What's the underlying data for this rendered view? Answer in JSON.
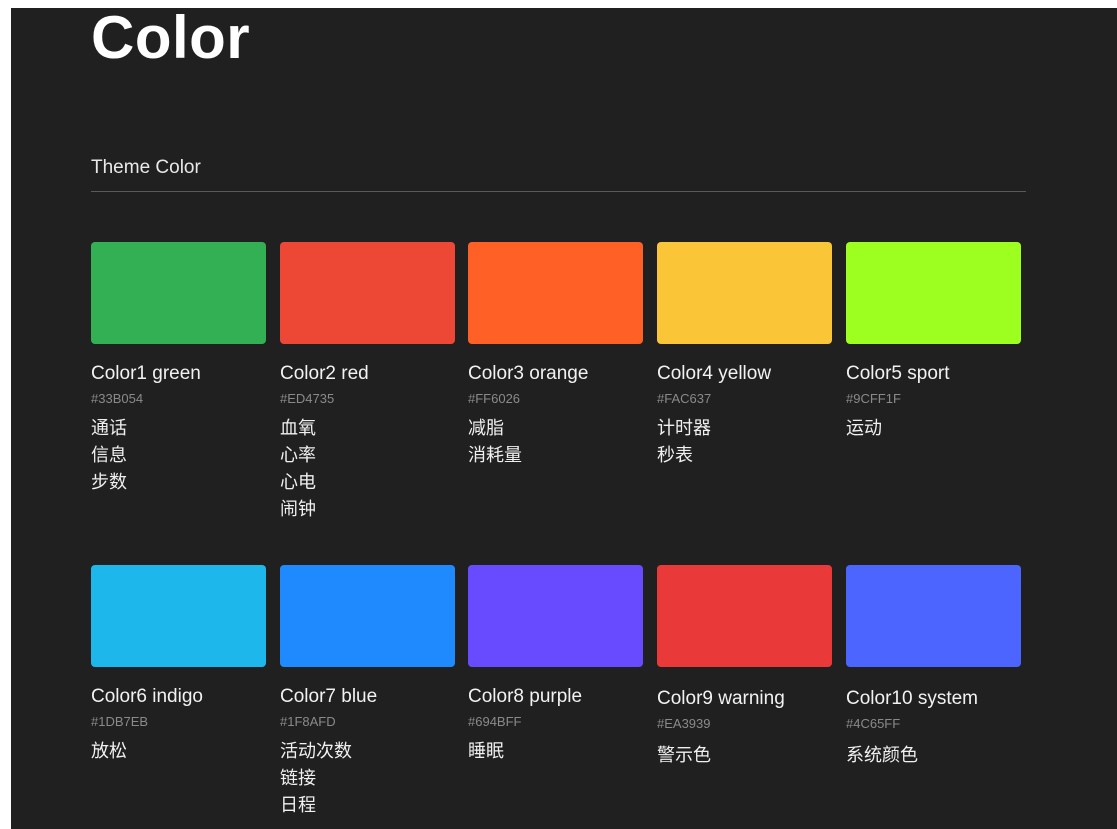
{
  "page": {
    "title": "Color",
    "section_label": "Theme Color"
  },
  "colors": [
    {
      "name": "Color1 green",
      "hex": "#33B054",
      "swatch": "#33B054",
      "uses": [
        "通话",
        "信息",
        "步数"
      ]
    },
    {
      "name": "Color2 red",
      "hex": "#ED4735",
      "swatch": "#ED4735",
      "uses": [
        "血氧",
        "心率",
        "心电",
        "闹钟"
      ]
    },
    {
      "name": "Color3 orange",
      "hex": "#FF6026",
      "swatch": "#FF6026",
      "uses": [
        "减脂",
        "消耗量"
      ]
    },
    {
      "name": "Color4 yellow",
      "hex": "#FAC637",
      "swatch": "#FAC637",
      "uses": [
        "计时器",
        "秒表"
      ]
    },
    {
      "name": "Color5 sport",
      "hex": "#9CFF1F",
      "swatch": "#9CFF1F",
      "uses": [
        "运动"
      ]
    },
    {
      "name": "Color6 indigo",
      "hex": "#1DB7EB",
      "swatch": "#1DB7EB",
      "uses": [
        "放松"
      ]
    },
    {
      "name": "Color7 blue",
      "hex": "#1F8AFD",
      "swatch": "#1F8AFD",
      "uses": [
        "活动次数",
        "链接",
        "日程"
      ]
    },
    {
      "name": "Color8 purple",
      "hex": "#694BFF",
      "swatch": "#694BFF",
      "uses": [
        "睡眠"
      ]
    },
    {
      "name": "Color9 warning",
      "hex": "#EA3939",
      "swatch": "#EA3939",
      "uses": [
        "警示色"
      ]
    },
    {
      "name": "Color10 system",
      "hex": "#4C65FF",
      "swatch": "#4C65FF",
      "uses": [
        "系统颜色"
      ]
    }
  ]
}
